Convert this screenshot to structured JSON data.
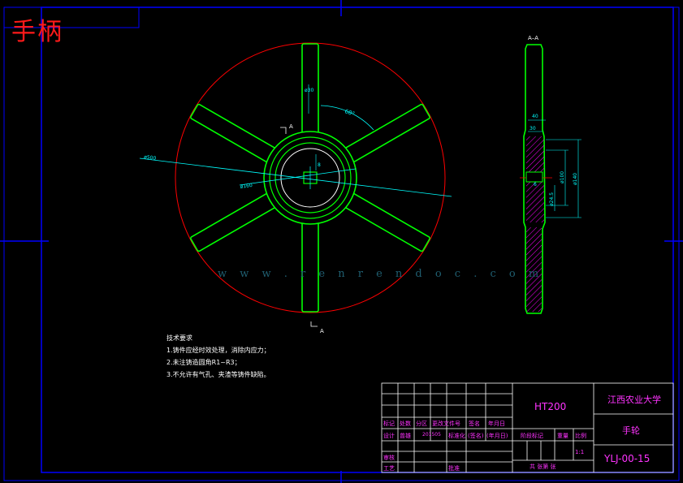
{
  "title": "手柄",
  "section_label": "A–A",
  "cut_label_top": "A",
  "cut_label_bottom": "A",
  "dims": {
    "hub_bore": "ø30",
    "angle": "60°",
    "outer_dia": "ø500",
    "hub_dia": "ø160",
    "key": "8",
    "sec_40": "40",
    "sec_30": "30",
    "sec_100": "ø100",
    "sec_140": "ø140",
    "sec_24": "ø24.5",
    "sec_6": "6"
  },
  "notes": {
    "heading": "技术要求",
    "items": [
      "1.铸件应经时效处理，消除内应力；",
      "2.未注铸造圆角R1~R3；",
      "3.不允许有气孔、夹渣等铸件缺陷。"
    ]
  },
  "title_block": {
    "material": "HT200",
    "school": "江西农业大学",
    "part_name": "手轮",
    "drawing_no": "YLJ-00-15",
    "scale_label": "比例",
    "scale": "1:1",
    "weight_label": "重量",
    "stage_label": "阶段标记",
    "sheet_text": "共   张第   张",
    "row_headers": [
      "标记",
      "处数",
      "分区",
      "更改文件号",
      "签名",
      "年月日"
    ],
    "design_row": [
      "设计",
      "曾雄",
      "201505",
      "标准化",
      "(签名)",
      "(年月日)"
    ],
    "review": "审核",
    "process": "工艺",
    "approve": "批准"
  },
  "watermark": "w w w . r e n r e n d o c . c o m",
  "colors": {
    "frame": "#0000ff",
    "outline": "#00ff00",
    "circle": "#ff0000",
    "dimension": "#00ffff",
    "title_red": "#ff1a1a",
    "tb_text": "#ff33ff",
    "hatch": "#ff00ff"
  }
}
